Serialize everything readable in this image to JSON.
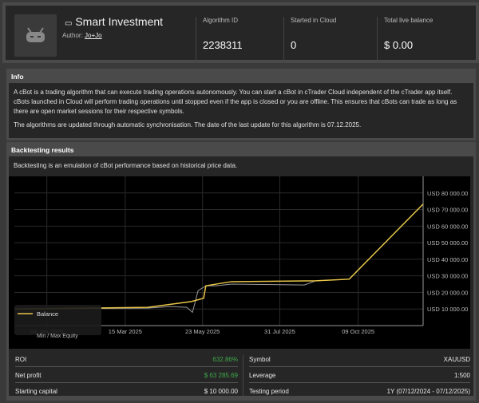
{
  "header": {
    "title": "Smart Investment",
    "author_label": "Author:",
    "author": "Jo+Jo",
    "stats": [
      {
        "label": "Algorithm ID",
        "value": "2238311"
      },
      {
        "label": "Started in Cloud",
        "value": "0"
      },
      {
        "label": "Total live balance",
        "value": "$ 0.00"
      }
    ]
  },
  "info": {
    "title": "Info",
    "p1": "A cBot is a trading algorithm that can execute trading operations autonomously. You can start a cBot in cTrader Cloud independent of the cTrader app itself. cBots launched in Cloud will perform trading operations until stopped even if the app is closed or you are offline. This ensures that cBots can trade as long as there are open market sessions for their respective symbols.",
    "p2": "The algorithms are updated through automatic synchronisation. The date of the last update for this algorithm is 07.12.2025."
  },
  "backtest": {
    "title": "Backtesting results",
    "desc": "Backtesting is an emulation of cBot performance based on historical price data."
  },
  "chart_data": {
    "type": "line",
    "xlabel": "",
    "ylabel": "",
    "x_ticks": [
      "04 Jan 2025",
      "15 Mar 2025",
      "23 May 2025",
      "31 Jul 2025",
      "09 Oct 2025"
    ],
    "y_ticks": [
      "USD 10 000.00",
      "USD 20 000.00",
      "USD 30 000.00",
      "USD 40 000.00",
      "USD 50 000.00",
      "USD 60 000.00",
      "USD 70 000.00",
      "USD 80 000.00"
    ],
    "ylim": [
      0,
      90000
    ],
    "x_days_range": [
      -29,
      336
    ],
    "x_tick_days": [
      0,
      70,
      139,
      208,
      278
    ],
    "legend": [
      "Balance",
      "Min / Max Equity"
    ],
    "legend_position": "bottom-left",
    "series": [
      {
        "name": "Balance",
        "color": "#e8c547",
        "days": [
          -29,
          90,
          129,
          140,
          142,
          151,
          165,
          240,
          270,
          336
        ],
        "values": [
          10000,
          11000,
          14500,
          16500,
          24000,
          25000,
          26500,
          27000,
          28000,
          73286
        ]
      },
      {
        "name": "Min / Max Equity",
        "color": "#9a9a9a",
        "days": [
          -29,
          90,
          110,
          125,
          130,
          132,
          135,
          142,
          151,
          165,
          230,
          240,
          270,
          336
        ],
        "values": [
          10000,
          10500,
          11500,
          11000,
          8000,
          13000,
          21000,
          24000,
          24000,
          25000,
          24500,
          27000,
          28000,
          73286
        ]
      }
    ]
  },
  "metrics": {
    "left": [
      {
        "label": "ROI",
        "value": "632.86%"
      },
      {
        "label": "Net profit",
        "value": "$ 63 285.69"
      },
      {
        "label": "Starting capital",
        "value": "$ 10 000.00"
      }
    ],
    "right": [
      {
        "label": "Symbol",
        "value": "XAUUSD"
      },
      {
        "label": "Leverage",
        "value": "1:500"
      },
      {
        "label": "Testing period",
        "value": "1Y (07/12/2024 - 07/12/2025)"
      }
    ]
  }
}
